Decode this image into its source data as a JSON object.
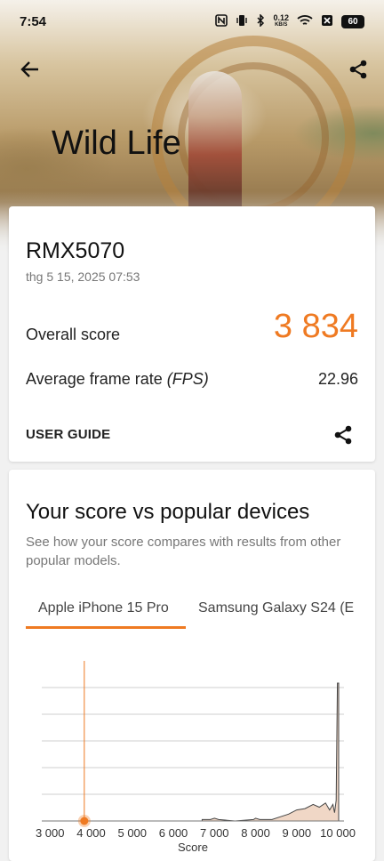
{
  "status": {
    "time": "7:54",
    "net_speed": "0.12",
    "net_unit": "KB/S",
    "battery": "60"
  },
  "hero": {
    "title": "Wild Life",
    "back_icon": "arrow-left-icon",
    "share_icon": "share-icon"
  },
  "result": {
    "device": "RMX5070",
    "date": "thg 5 15, 2025 07:53",
    "overall_label": "Overall score",
    "overall_value": "3 834",
    "fps_label_prefix": "Average frame rate ",
    "fps_label_unit": "(FPS)",
    "fps_value": "22.96",
    "user_guide": "USER GUIDE",
    "accent": "#ef7a22"
  },
  "compare": {
    "title": "Your score vs popular devices",
    "description": "See how your score compares with results from other popular models.",
    "tabs": [
      "Apple iPhone 15 Pro",
      "Samsung Galaxy S24 (E"
    ],
    "selected_tab": 0
  },
  "chart_data": {
    "type": "area",
    "xlabel": "Score",
    "x_ticks": [
      "3 000",
      "4 000",
      "5 000",
      "6 000",
      "7 000",
      "8 000",
      "9 000",
      "10 000"
    ],
    "xlim": [
      2800,
      10150
    ],
    "grid": true,
    "your_score": 3834,
    "distribution": [
      {
        "x": 6700,
        "y": 0.01
      },
      {
        "x": 6900,
        "y": 0.01
      },
      {
        "x": 7000,
        "y": 0.02
      },
      {
        "x": 7100,
        "y": 0.01
      },
      {
        "x": 7500,
        "y": 0.0
      },
      {
        "x": 7950,
        "y": 0.01
      },
      {
        "x": 8000,
        "y": 0.02
      },
      {
        "x": 8100,
        "y": 0.01
      },
      {
        "x": 8400,
        "y": 0.01
      },
      {
        "x": 8600,
        "y": 0.03
      },
      {
        "x": 8800,
        "y": 0.05
      },
      {
        "x": 9000,
        "y": 0.08
      },
      {
        "x": 9200,
        "y": 0.09
      },
      {
        "x": 9400,
        "y": 0.12
      },
      {
        "x": 9550,
        "y": 0.1
      },
      {
        "x": 9700,
        "y": 0.13
      },
      {
        "x": 9800,
        "y": 0.08
      },
      {
        "x": 9880,
        "y": 0.12
      },
      {
        "x": 9920,
        "y": 0.06
      },
      {
        "x": 9960,
        "y": 0.15
      },
      {
        "x": 9990,
        "y": 1.0
      },
      {
        "x": 10020,
        "y": 1.0
      }
    ]
  }
}
